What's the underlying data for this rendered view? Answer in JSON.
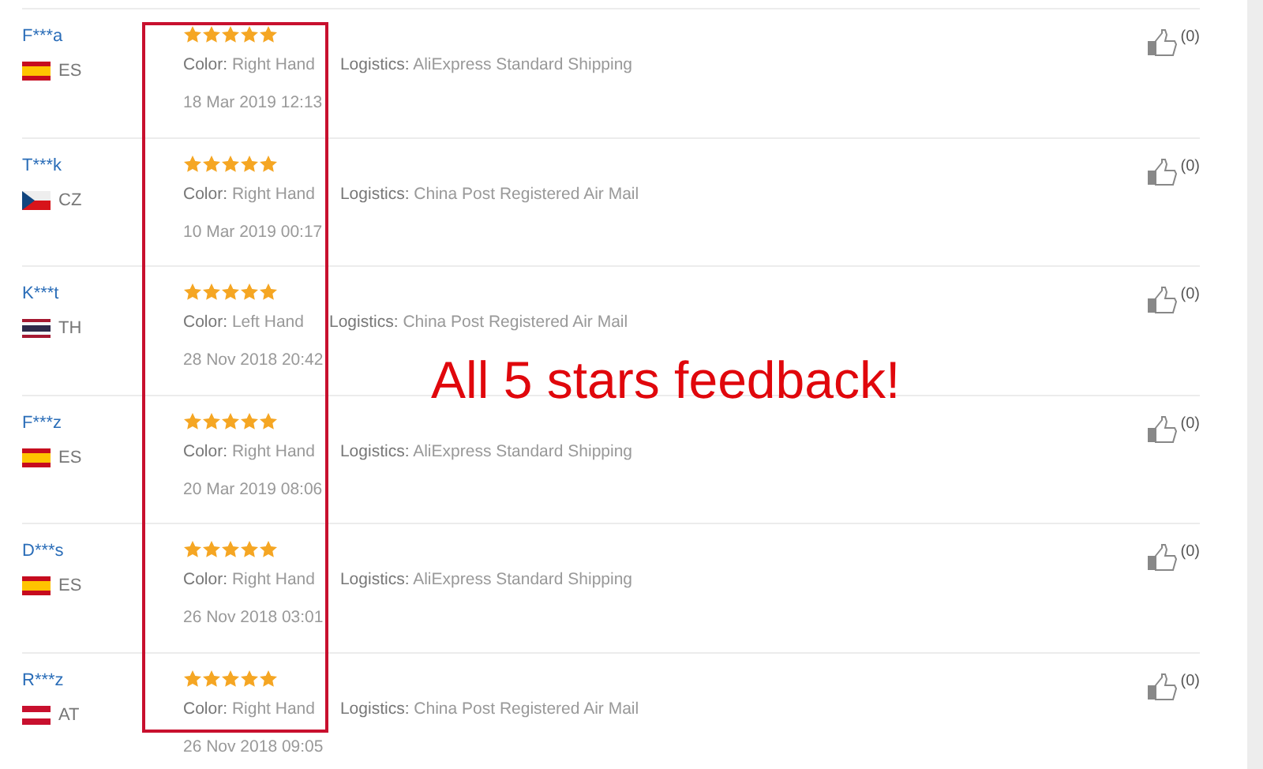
{
  "reviews": [
    {
      "name": "F***a",
      "kind": "spain",
      "country": "ES",
      "stars": 5,
      "color_label": "Color:",
      "variant": "Right Hand",
      "logistics_label": "Logistics:",
      "logistics": "AliExpress Standard Shipping",
      "date": "18 Mar 2019 12:13",
      "likes": "(0)"
    },
    {
      "name": "T***k",
      "kind": "czech",
      "country": "CZ",
      "stars": 5,
      "color_label": "Color:",
      "variant": "Right Hand",
      "logistics_label": "Logistics:",
      "logistics": "China Post Registered Air Mail",
      "date": "10 Mar 2019 00:17",
      "likes": "(0)"
    },
    {
      "name": "K***t",
      "kind": "thailand",
      "country": "TH",
      "stars": 5,
      "color_label": "Color:",
      "variant": "Left Hand",
      "logistics_label": "Logistics:",
      "logistics": "China Post Registered Air Mail",
      "date": "28 Nov 2018 20:42",
      "likes": "(0)"
    },
    {
      "name": "F***z",
      "kind": "spain",
      "country": "ES",
      "stars": 5,
      "color_label": "Color:",
      "variant": "Right Hand",
      "logistics_label": "Logistics:",
      "logistics": "AliExpress Standard Shipping",
      "date": "20 Mar 2019 08:06",
      "likes": "(0)"
    },
    {
      "name": "D***s",
      "kind": "spain",
      "country": "ES",
      "stars": 5,
      "color_label": "Color:",
      "variant": "Right Hand",
      "logistics_label": "Logistics:",
      "logistics": "AliExpress Standard Shipping",
      "date": "26 Nov 2018 03:01",
      "likes": "(0)"
    },
    {
      "name": "R***z",
      "kind": "austria",
      "country": "AT",
      "stars": 5,
      "color_label": "Color:",
      "variant": "Right Hand",
      "logistics_label": "Logistics:",
      "logistics": "China Post Registered Air Mail",
      "date": "26 Nov 2018 09:05",
      "likes": "(0)"
    }
  ],
  "annotation": "All 5 stars feedback!"
}
